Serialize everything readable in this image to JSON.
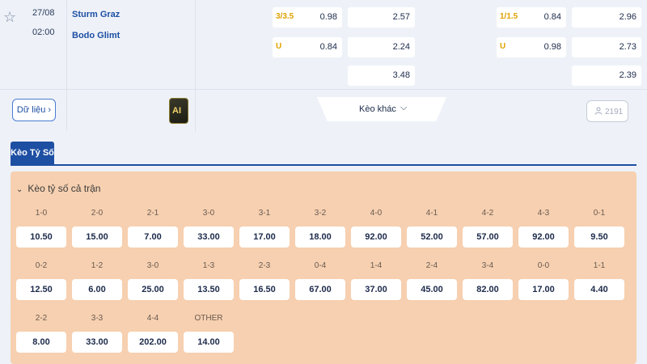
{
  "match": {
    "date": "27/08",
    "time": "02:00",
    "home_team": "Sturm Graz",
    "away_team": "Bodo Glimt",
    "ft_handicap": [
      {
        "hcap": "3/3.5",
        "odds": "0.98"
      },
      {
        "hcap": "U",
        "odds": "0.84"
      }
    ],
    "ft_1x2": [
      "2.57",
      "2.24",
      "3.48"
    ],
    "ht_handicap": [
      {
        "hcap": "1/1.5",
        "odds": "0.84"
      },
      {
        "hcap": "U",
        "odds": "0.98"
      }
    ],
    "ht_1x2": [
      "2.96",
      "2.73",
      "2.39"
    ]
  },
  "actions": {
    "data_label": "Dữ liệu ›",
    "ai_label": "AI",
    "more_label": "Kèo khác",
    "more_chevron": "⌵",
    "viewers_count": "2191"
  },
  "tabs": {
    "active": "Kèo Tỷ Số"
  },
  "panel": {
    "title": "Kèo tỷ số cả trận",
    "scores": [
      {
        "score": "1-0",
        "odds": "10.50"
      },
      {
        "score": "2-0",
        "odds": "15.00"
      },
      {
        "score": "2-1",
        "odds": "7.00"
      },
      {
        "score": "3-0",
        "odds": "33.00"
      },
      {
        "score": "3-1",
        "odds": "17.00"
      },
      {
        "score": "3-2",
        "odds": "18.00"
      },
      {
        "score": "4-0",
        "odds": "92.00"
      },
      {
        "score": "4-1",
        "odds": "52.00"
      },
      {
        "score": "4-2",
        "odds": "57.00"
      },
      {
        "score": "4-3",
        "odds": "92.00"
      },
      {
        "score": "0-1",
        "odds": "9.50"
      },
      {
        "score": "0-2",
        "odds": "12.50"
      },
      {
        "score": "1-2",
        "odds": "6.00"
      },
      {
        "score": "3-0",
        "odds": "25.00"
      },
      {
        "score": "1-3",
        "odds": "13.50"
      },
      {
        "score": "2-3",
        "odds": "16.50"
      },
      {
        "score": "0-4",
        "odds": "67.00"
      },
      {
        "score": "1-4",
        "odds": "37.00"
      },
      {
        "score": "2-4",
        "odds": "45.00"
      },
      {
        "score": "3-4",
        "odds": "82.00"
      },
      {
        "score": "0-0",
        "odds": "17.00"
      },
      {
        "score": "1-1",
        "odds": "4.40"
      },
      {
        "score": "2-2",
        "odds": "8.00"
      },
      {
        "score": "3-3",
        "odds": "33.00"
      },
      {
        "score": "4-4",
        "odds": "202.00"
      },
      {
        "score": "OTHER",
        "odds": "14.00"
      }
    ]
  },
  "icons": {
    "star": "star-outline-icon",
    "viewers": "user-icon",
    "caret": "chevron-down-icon"
  }
}
